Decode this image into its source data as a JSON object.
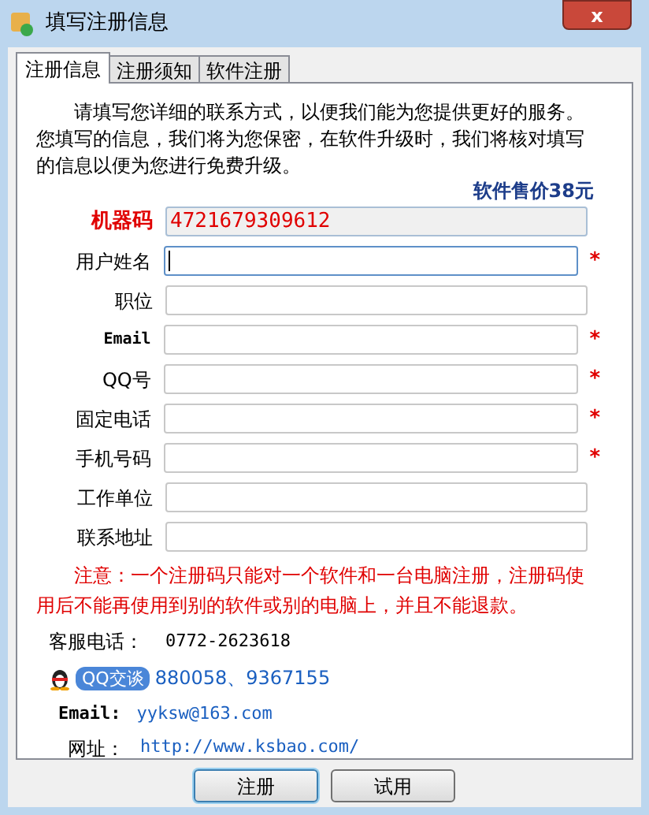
{
  "window": {
    "title": "填写注册信息",
    "close": "x"
  },
  "tabs": [
    {
      "label": "注册信息",
      "selected": true
    },
    {
      "label": "注册须知",
      "selected": false
    },
    {
      "label": "软件注册",
      "selected": false
    }
  ],
  "intro": "请填写您详细的联系方式，以便我们能为您提供更好的服务。您填写的信息，我们将为您保密，在软件升级时，我们将核对填写的信息以便为您进行免费升级。",
  "price": "软件售价38元",
  "fields": [
    {
      "label": "机器码",
      "kind": "machine",
      "value": "4721679309612",
      "required": false,
      "focused": false
    },
    {
      "label": "用户姓名",
      "kind": "text",
      "required": true,
      "focused": true
    },
    {
      "label": "职位",
      "kind": "text",
      "required": false,
      "focused": false
    },
    {
      "label": "Email",
      "kind": "latin",
      "required": true,
      "focused": false
    },
    {
      "label": "QQ号",
      "kind": "text",
      "required": true,
      "focused": false
    },
    {
      "label": "固定电话",
      "kind": "text",
      "required": true,
      "focused": false
    },
    {
      "label": "手机号码",
      "kind": "text",
      "required": true,
      "focused": false
    },
    {
      "label": "工作单位",
      "kind": "text",
      "required": false,
      "focused": false
    },
    {
      "label": "联系地址",
      "kind": "text",
      "required": false,
      "focused": false
    }
  ],
  "required_mark": "*",
  "notice": "注意：一个注册码只能对一个软件和一台电脑注册，注册码使用后不能再使用到别的软件或别的电脑上，并且不能退款。",
  "contacts": {
    "phone_label": "客服电话：",
    "phone": "0772-2623618",
    "qq_badge": "QQ交谈",
    "qq": "880058、9367155",
    "email_label": "Email:",
    "email": "yyksw@163.com",
    "site_label": "网址：",
    "site": "http://www.ksbao.com/"
  },
  "buttons": [
    {
      "label": "注册",
      "default": true
    },
    {
      "label": "试用",
      "default": false
    }
  ]
}
